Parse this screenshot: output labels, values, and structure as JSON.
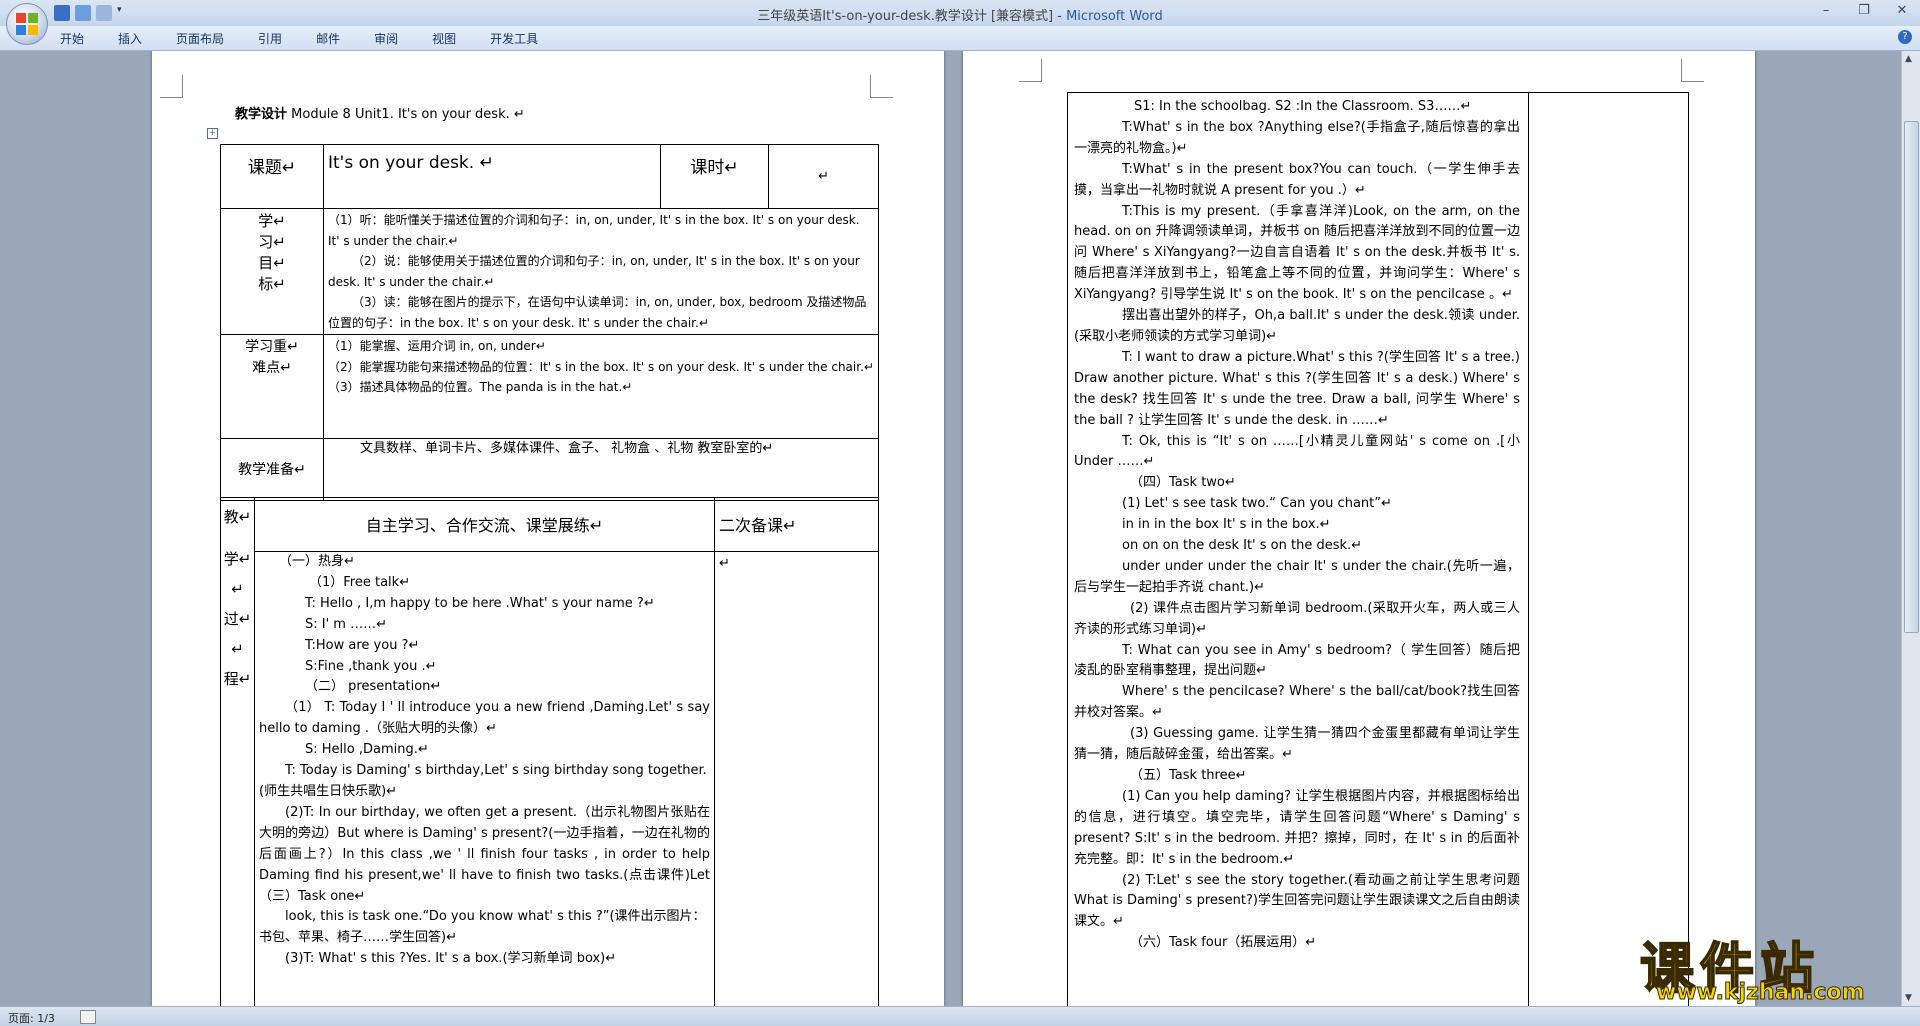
{
  "window": {
    "title": "三年级英语It's-on-your-desk.教学设计 [兼容模式] - ",
    "app_name": "Microsoft Word",
    "minimize": "–",
    "maximize": "❐",
    "close": "✕"
  },
  "ribbon": {
    "tabs": [
      "开始",
      "插入",
      "页面布局",
      "引用",
      "邮件",
      "审阅",
      "视图",
      "开发工具"
    ],
    "help": "?"
  },
  "status": {
    "page": "页面: 1/3"
  },
  "page1": {
    "title_bold": "教学设计",
    "title_rest": " Module 8 Unit1. It's on your desk. ↵",
    "table1": {
      "topic_label": "课题↵",
      "topic_value": "It's on your desk. ↵",
      "period_label": "课时↵",
      "period_value": "↵",
      "goal_label": [
        "学↵",
        "习↵",
        "目↵",
        "标↵"
      ],
      "goals": [
        "（1）听：能听懂关于描述位置的介词和句子：in, on, under, It' s in the box. It' s on your desk. It' s under the chair.↵",
        "（2）说：能够使用关于描述位置的介词和句子：in, on, under, It' s in the box. It' s on your desk. It' s under the chair.↵",
        "（3）读：能够在图片的提示下，在语句中认读单词：in, on, under, box, bedroom 及描述物品位置的句子：in the box. It' s on your desk. It' s under the chair.↵"
      ],
      "key_label": [
        "学习重↵",
        "难点↵"
      ],
      "keys": [
        "（1）能掌握、运用介词 in, on, under↵",
        "（2）能掌握功能句来描述物品的位置：It' s in the box. It' s on your desk. It' s under the chair.↵",
        "（3）描述具体物品的位置。The panda is in the hat.↵"
      ],
      "prep_label": "教学准备↵",
      "prep_value": "文具数样、单词卡片、多媒体课件、盒子、 礼物盒 、礼物 教室卧室的↵"
    },
    "table2": {
      "side_labels": [
        "教↵",
        "学↵",
        "↵",
        "过↵",
        "↵",
        "程↵"
      ],
      "header_mid": "自主学习、合作交流、课堂展练↵",
      "header_right": "二次备课↵",
      "right_mark": "↵",
      "lines": [
        "（一）热身↵",
        "（1）Free talk↵",
        "T: Hello , I,m happy to be here .What' s your name ?↵",
        "S: I' m ……↵",
        "T:How are you ?↵",
        "S:Fine ,thank you .↵",
        "（二） presentation↵",
        "（1） T: Today I ' ll introduce you a new friend ,Daming.Let' s say hello to daming .（张贴大明的头像）↵",
        "S: Hello ,Daming.↵",
        "T: Today is Daming' s birthday,Let' s sing birthday song together.(师生共唱生日快乐歌)↵",
        "(2)T: In our birthday, we often get a present.（出示礼物图片张贴在大明的旁边）But where is Daming' s present?(一边手指着，一边在礼物的后面画上?）In this class ,we ' ll finish four tasks , in order to help Daming find his present,we' ll have to finish two tasks.(点击课件)Let（三）Task one↵",
        "look, this is task one.“Do you know what' s this ?”(课件出示图片：书包、苹果、椅子……学生回答)↵",
        "(3)T: What' s this ?Yes. It' s a box.(学习新单词 box)↵"
      ]
    }
  },
  "page2": {
    "lines": [
      "S1: In the schoolbag. S2 :In the Classroom. S3……↵",
      "T:What' s in the box ?Anything else?(手指盒子,随后惊喜的拿出一漂亮的礼物盒。)↵",
      "T:What' s in the present box?You can touch.（一学生伸手去摸，当拿出一礼物时就说 A present for you .）↵",
      "T:This is my present.（手拿喜洋洋)Look, on the arm, on the head. on on 升降调领读单词，并板书 on 随后把喜洋洋放到不同的位置一边问 Where' s XiYangyang?一边自言自语着 It' s on the desk.并板书 It' s. 随后把喜洋洋放到书上，铅笔盒上等不同的位置，并询问学生：Where' s XiYangyang? 引导学生说 It' s on the book. It' s on the pencilcase 。↵",
      "摆出喜出望外的样子，Oh,a ball.It' s under the desk.领读 under.(采取小老师领读的方式学习单词)↵",
      "T: I want to draw a picture.What' s this ?(学生回答 It' s a tree.) Draw another picture. What' s this ?(学生回答 It' s a desk.) Where' s the desk? 找生回答 It' s unde the tree. Draw a ball, 问学生 Where' s the ball ? 让学生回答 It' s unde the desk. in ……↵",
      "T: Ok, this is “It' s on ……[小精灵儿童网站' s come on .[小 Under ……↵",
      "（四）Task two↵",
      "(1) Let' s see task two.“ Can you chant”↵",
      "in in in the box It' s in the box.↵",
      "on on on the desk It' s on the desk.↵",
      "under under under the chair It' s under the chair.(先听一遍，后与学生一起拍手齐说 chant.)↵",
      "(2) 课件点击图片学习新单词 bedroom.(采取开火车，两人或三人齐读的形式练习单词)↵",
      "T: What can you see in Amy' s bedroom?（ 学生回答）随后把凌乱的卧室稍事整理，提出问题↵",
      "Where' s the pencilcase? Where' s the ball/cat/book?找生回答并校对答案。↵",
      "(3) Guessing game. 让学生猜一猜四个金蛋里都藏有单词让学生猜一猜，随后敲碎金蛋，给出答案。↵",
      "（五）Task three↵",
      "(1) Can you help daming? 让学生根据图片内容，并根据图标给出的信息，进行填空。填空完毕，请学生回答问题“Where' s Daming' s present? S:It' s in the bedroom. 并把？擦掉，同时，在 It' s in 的后面补充完整。即：It' s in the bedroom.↵",
      "(2) T:Let' s see the story together.(看动画之前让学生思考问题 What is Daming' s present?)学生回答完问题让学生跟读课文之后自由朗读课文。↵",
      "（六）Task four（拓展运用）↵"
    ]
  },
  "watermark": {
    "main": "课件站",
    "url": "www.kjzhan.com"
  }
}
